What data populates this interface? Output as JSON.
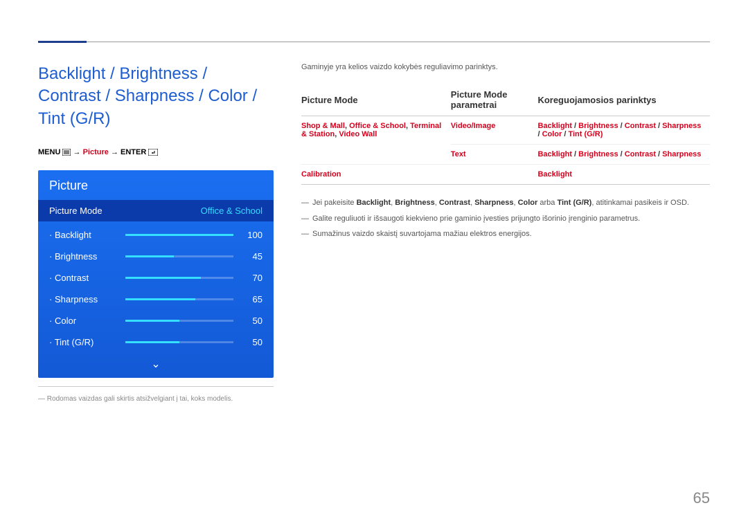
{
  "heading": "Backlight / Brightness / Contrast / Sharpness / Color / Tint (G/R)",
  "menu_path": {
    "menu": "MENU",
    "arrow": "→",
    "picture": "Picture",
    "enter": "ENTER"
  },
  "osd": {
    "title": "Picture",
    "highlight_label": "Picture Mode",
    "highlight_value": "Office & School",
    "rows": [
      {
        "label": "Backlight",
        "value": "100",
        "pct": 100
      },
      {
        "label": "Brightness",
        "value": "45",
        "pct": 45
      },
      {
        "label": "Contrast",
        "value": "70",
        "pct": 70
      },
      {
        "label": "Sharpness",
        "value": "65",
        "pct": 65
      },
      {
        "label": "Color",
        "value": "50",
        "pct": 50
      },
      {
        "label": "Tint (G/R)",
        "value": "50",
        "pct": 50
      }
    ]
  },
  "footnote": "Rodomas vaizdas gali skirtis atsižvelgiant į tai, koks modelis.",
  "intro": "Gaminyje yra kelios vaizdo kokybės reguliavimo parinktys.",
  "table_head": {
    "c1": "Picture Mode",
    "c2": "Picture Mode parametrai",
    "c3": "Koreguojamosios parinktys"
  },
  "table_rows": [
    {
      "c1_parts": [
        "Shop & Mall",
        ", ",
        "Office & School",
        ", ",
        "Terminal & Station",
        ", ",
        "Video Wall"
      ],
      "c2_parts": [
        "Video/Image"
      ],
      "c3_parts": [
        "Backlight",
        " / ",
        "Brightness",
        " / ",
        "Contrast",
        " / ",
        "Sharpness",
        " / ",
        "Color",
        " / ",
        "Tint (G/R)"
      ]
    },
    {
      "c1_parts": [],
      "c2_parts": [
        "Text"
      ],
      "c3_parts": [
        "Backlight",
        " / ",
        "Brightness",
        " / ",
        "Contrast",
        " / ",
        "Sharpness"
      ]
    },
    {
      "c1_parts": [
        "Calibration"
      ],
      "c2_parts": [],
      "c3_parts": [
        "Backlight"
      ]
    }
  ],
  "notes": {
    "n1_pre": "Jei pakeisite ",
    "n1_bold": [
      "Backlight",
      "Brightness",
      "Contrast",
      "Sharpness",
      "Color"
    ],
    "n1_sep": ", ",
    "n1_or": " arba ",
    "n1_last": "Tint (G/R)",
    "n1_post": ", atitinkamai pasikeis ir OSD.",
    "n2": "Galite reguliuoti ir išsaugoti kiekvieno prie gaminio įvesties prijungto išorinio įrenginio parametrus.",
    "n3": "Sumažinus vaizdo skaistį suvartojama mažiau elektros energijos."
  },
  "page_number": "65"
}
